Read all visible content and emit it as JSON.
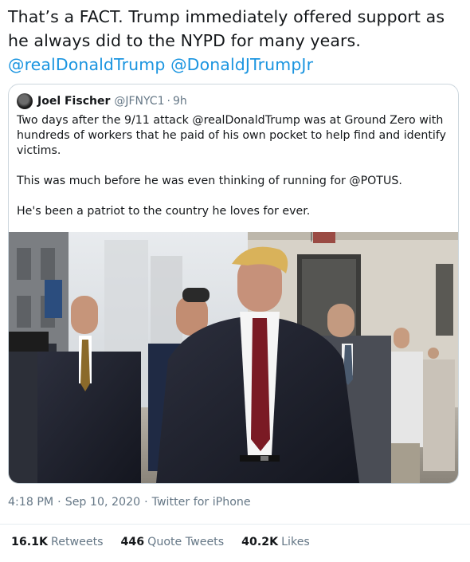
{
  "tweet": {
    "line1": "That’s a FACT. Trump immediately offered support as",
    "line2": "he always did to the NYPD for many years.",
    "mention1": "@realDonaldTrump",
    "mention2": "@DonaldJTrumpJr"
  },
  "quote": {
    "name": "Joel Fischer",
    "handle": "@JFNYC1",
    "sep": "·",
    "time": "9h",
    "para1": "Two days after the 9/11 attack @realDonaldTrump was at Ground Zero with hundreds of workers that he paid of his own pocket to help find and identify victims.",
    "para2": "This was much before he was even thinking of running for @POTUS.",
    "para3": "He's been a patriot to the country he loves for ever."
  },
  "meta": {
    "time": "4:18 PM",
    "date": "Sep 10, 2020",
    "source": "Twitter for iPhone",
    "sep": "·"
  },
  "stats": {
    "retweets_count": "16.1K",
    "retweets_label": "Retweets",
    "quotes_count": "446",
    "quotes_label": "Quote Tweets",
    "likes_count": "40.2K",
    "likes_label": "Likes"
  },
  "colors": {
    "link": "#1b95e0",
    "secondary": "#657786",
    "border": "#ccd6dd"
  },
  "icons": {
    "avatar": "profile-photo"
  }
}
